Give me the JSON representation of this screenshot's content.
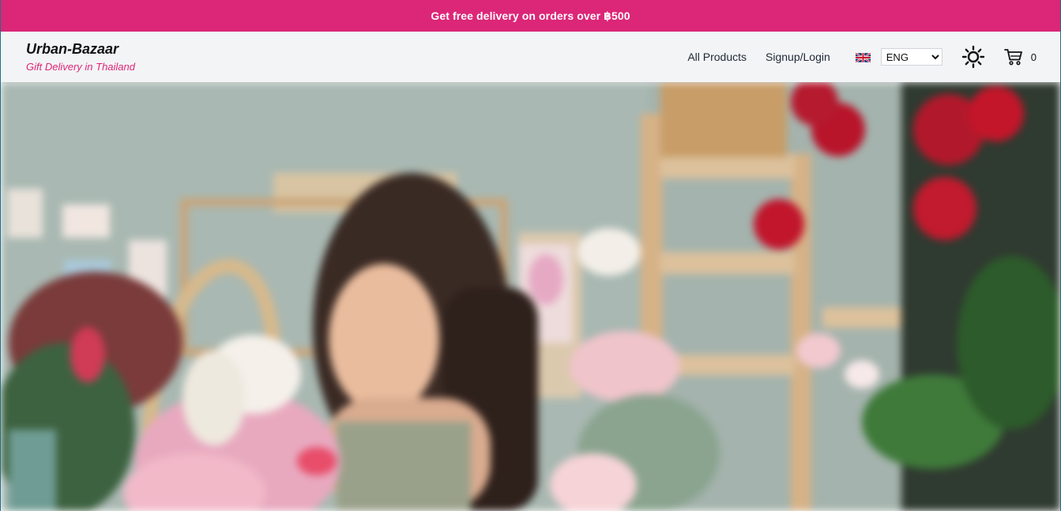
{
  "promo": {
    "text": "Get free delivery on orders over ฿500"
  },
  "brand": {
    "name": "Urban-Bazaar",
    "tagline": "Gift Delivery in Thailand"
  },
  "nav": {
    "all_products": "All Products",
    "signup_login": "Signup/Login"
  },
  "language": {
    "flag_icon": "uk-flag-icon",
    "selected": "ENG"
  },
  "theme_toggle": {
    "icon": "sun-icon"
  },
  "cart": {
    "icon": "cart-icon",
    "count": "0"
  },
  "colors": {
    "accent": "#dc2678",
    "header_bg": "#f3f4f6"
  }
}
